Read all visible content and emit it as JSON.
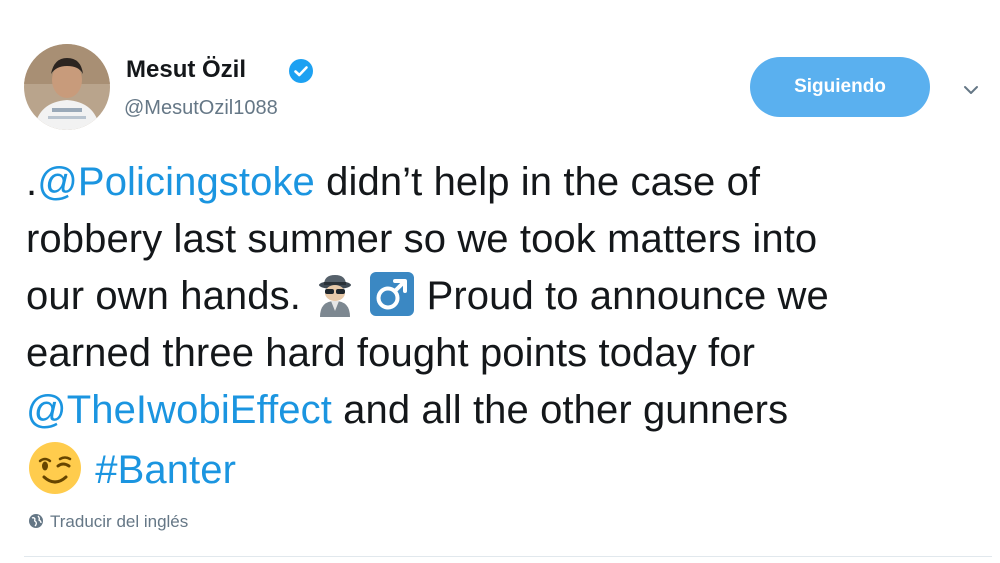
{
  "author": {
    "display_name": "Mesut Özil",
    "handle": "@MesutOzil1088",
    "verified": true,
    "avatar": "profile-photo"
  },
  "actions": {
    "follow_label": "Siguiendo",
    "menu_icon": "chevron-down-icon"
  },
  "tweet": {
    "mention_1": "@Policingstoke",
    "line1_rest": " didn’t help in the case of",
    "line2": "robbery last summer so we took matters into",
    "line3_start": "our own hands. ",
    "emoji_1": "detective-emoji",
    "emoji_2": "male-sign-emoji",
    "line3_rest": " Proud to announce we",
    "line4": "earned three hard fought points today for",
    "mention_2": "@TheIwobiEffect",
    "line5_rest": " and all the other gunners",
    "emoji_3": "winking-face-emoji",
    "hashtag": "#Banter"
  },
  "translate": {
    "label": "Traducir del inglés",
    "icon": "globe-icon"
  },
  "colors": {
    "link": "#1b95e0",
    "follow_button": "#5ab0ef",
    "secondary_text": "#657786",
    "primary_text": "#14171a",
    "verified_badge": "#1da1f2"
  }
}
